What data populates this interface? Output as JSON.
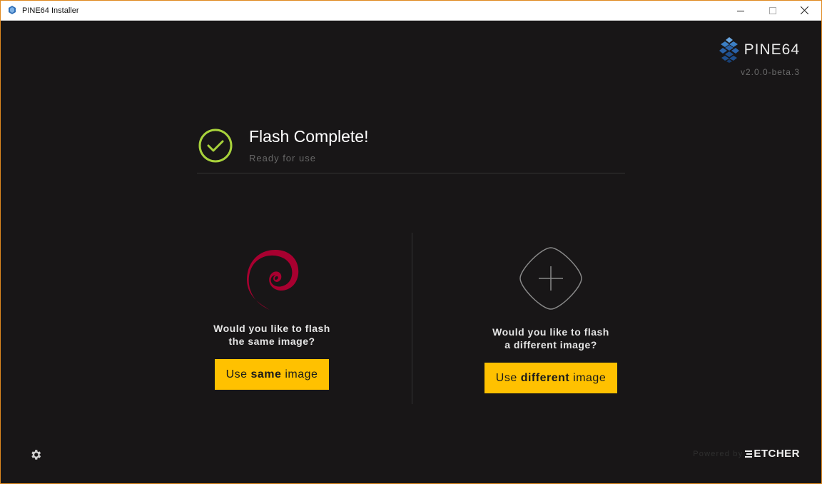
{
  "window": {
    "title": "PINE64 Installer",
    "accent_border": "#e0891f"
  },
  "brand": {
    "name": "PINE64",
    "version": "v2.0.0-beta.3"
  },
  "status": {
    "title": "Flash Complete!",
    "subtitle": "Ready for use",
    "check_color": "#a8d23b"
  },
  "same_image": {
    "question_line1": "Would you like to flash",
    "question_line2": "the same image?",
    "button_prefix": "Use ",
    "button_bold": "same",
    "button_suffix": " image",
    "image_icon": "debian-swirl-icon"
  },
  "different_image": {
    "question_line1": "Would you like to flash",
    "question_line2": "a different image?",
    "button_prefix": "Use ",
    "button_bold": "different",
    "button_suffix": " image",
    "image_icon": "plus-icon"
  },
  "footer": {
    "powered_by": "Powered by",
    "engine": "ETCHER",
    "settings_icon": "gear-icon"
  },
  "colors": {
    "background": "#181617",
    "button": "#ffc100",
    "debian_red": "#a80030"
  }
}
